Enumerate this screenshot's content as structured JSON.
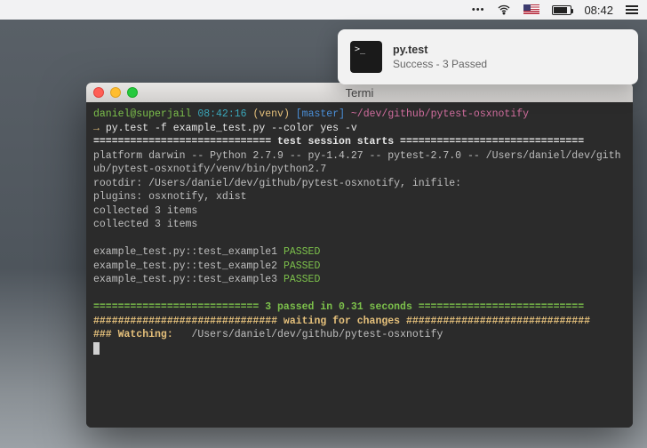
{
  "menubar": {
    "clock": "08:42"
  },
  "notification": {
    "icon_label": ">_",
    "title": "py.test",
    "subtitle": "Success - 3 Passed"
  },
  "terminal": {
    "title": "Termi",
    "prompt": {
      "user_host": "daniel@superjail",
      "time": "08:42:16",
      "venv": "(venv)",
      "branch": "[master]",
      "cwd": "~/dev/github/pytest-osxnotify",
      "symbol": "→"
    },
    "command": "py.test -f example_test.py --color yes -v",
    "session_header_eq": "============================= test session starts ==============================",
    "platform_line": "platform darwin -- Python 2.7.9 -- py-1.4.27 -- pytest-2.7.0 -- /Users/daniel/dev/github/pytest-osxnotify/venv/bin/python2.7",
    "rootdir_line": "rootdir: /Users/daniel/dev/github/pytest-osxnotify, inifile:",
    "plugins_line": "plugins: osxnotify, xdist",
    "collected_a": "collected 3 items",
    "collected_b": "collected 3 items",
    "tests": [
      {
        "name": "example_test.py::test_example1",
        "status": "PASSED"
      },
      {
        "name": "example_test.py::test_example2",
        "status": "PASSED"
      },
      {
        "name": "example_test.py::test_example3",
        "status": "PASSED"
      }
    ],
    "summary_eq": "=========================== 3 passed in 0.31 seconds ===========================",
    "waiting_line": "############################## waiting for changes ##############################",
    "watching_label": "### Watching:",
    "watching_path": "/Users/daniel/dev/github/pytest-osxnotify"
  }
}
